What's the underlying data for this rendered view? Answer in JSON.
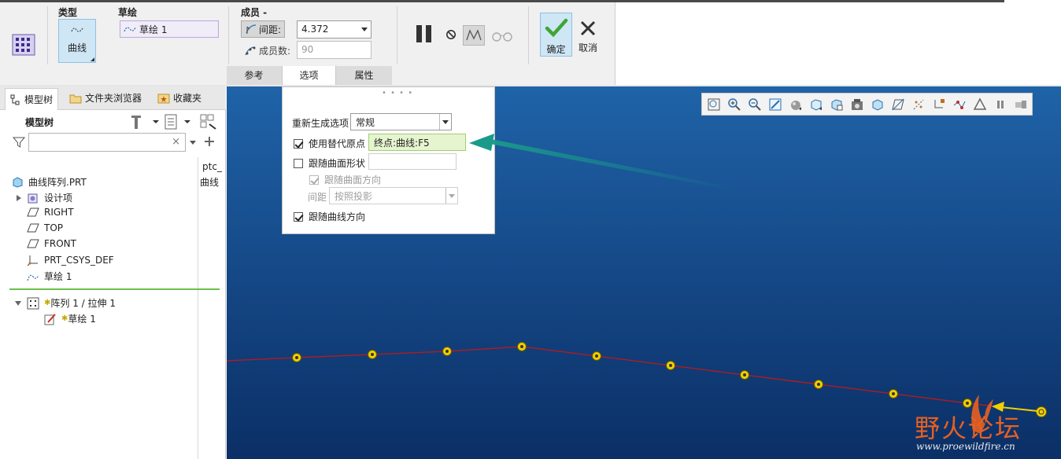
{
  "ribbon": {
    "type_label": "类型",
    "type_button": "曲线",
    "sketch_label": "草绘",
    "sketch_value": "草绘 1",
    "members_label": "成员 -",
    "spacing_label": "间距:",
    "spacing_value": "4.372",
    "member_count_label": "成员数:",
    "member_count_placeholder": "90",
    "tabs": [
      "参考",
      "选项",
      "属性"
    ],
    "confirm": "确定",
    "cancel": "取消"
  },
  "left_panel": {
    "tabs": [
      "模型树",
      "文件夹浏览器",
      "收藏夹"
    ],
    "tree_title": "模型树",
    "filter_placeholder": "",
    "column_header": "ptc_",
    "column_value": "曲线",
    "items": [
      {
        "label": "曲线阵列.PRT",
        "icon": "part-icon"
      },
      {
        "label": "设计项",
        "icon": "design-items-icon"
      },
      {
        "label": "RIGHT",
        "icon": "datum-plane-icon"
      },
      {
        "label": "TOP",
        "icon": "datum-plane-icon"
      },
      {
        "label": "FRONT",
        "icon": "datum-plane-icon"
      },
      {
        "label": "PRT_CSYS_DEF",
        "icon": "csys-icon"
      },
      {
        "label": "草绘 1",
        "icon": "sketch-icon"
      }
    ],
    "pattern_item": "阵列 1 / 拉伸 1",
    "pattern_child": "草绘 1"
  },
  "options": {
    "regen_label": "重新生成选项",
    "regen_value": "常规",
    "alt_origin_label": "使用替代原点",
    "alt_origin_checked": true,
    "alt_origin_value": "终点:曲线:F5",
    "follow_surface_shape_label": "跟随曲面形状",
    "follow_surface_shape_checked": false,
    "follow_surface_dir_label": "跟随曲面方向",
    "follow_surface_dir_checked": true,
    "spacing_label": "间距",
    "spacing_value": "按照投影",
    "follow_curve_dir_label": "跟随曲线方向",
    "follow_curve_dir_checked": true
  },
  "watermark": {
    "title": "野火论坛",
    "url": "www.proewildfire.cn"
  },
  "colors": {
    "accent_green": "#3fa535",
    "curve_red": "#c01818",
    "point_yellow": "#f0d000",
    "arrow_teal": "#1a9a8a"
  }
}
